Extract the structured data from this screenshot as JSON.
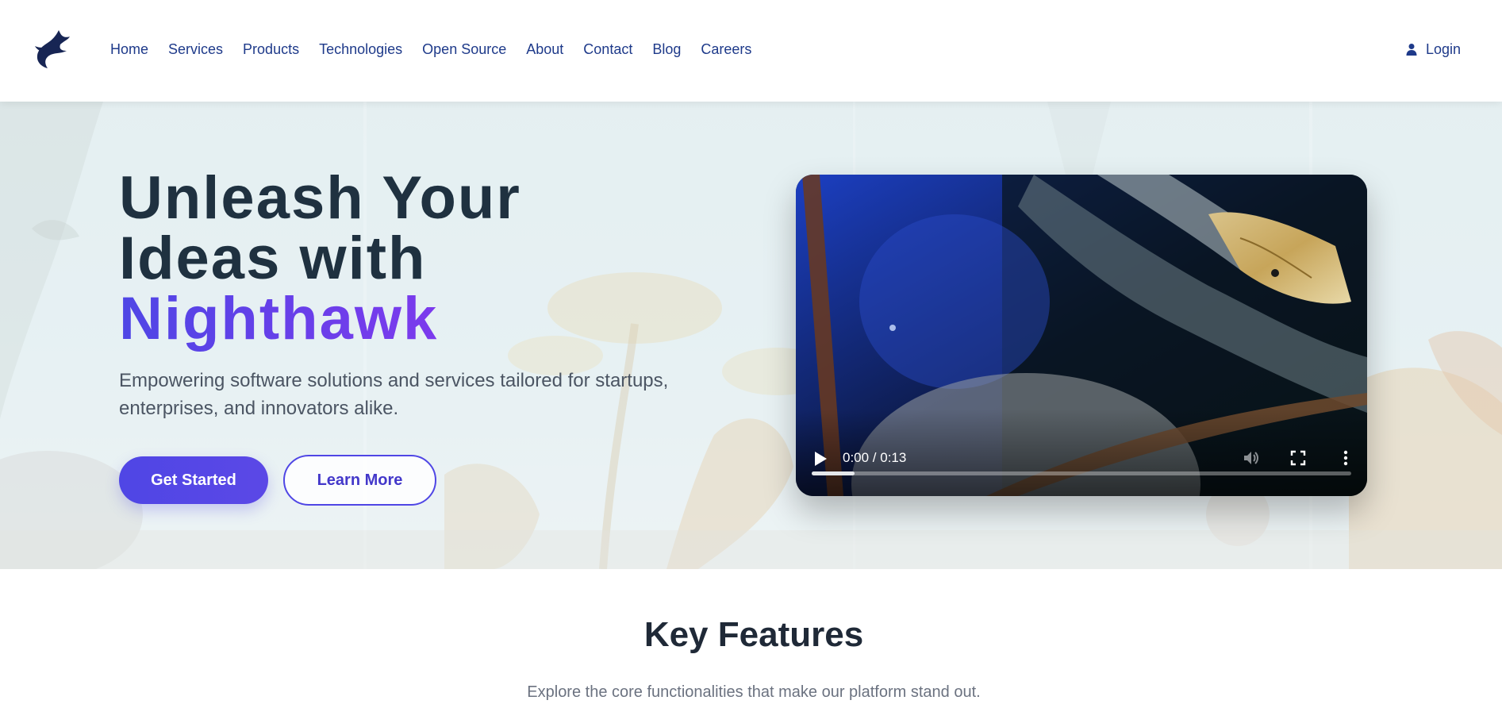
{
  "nav": {
    "links": [
      "Home",
      "Services",
      "Products",
      "Technologies",
      "Open Source",
      "About",
      "Contact",
      "Blog",
      "Careers"
    ],
    "login_label": "Login"
  },
  "hero": {
    "headline_line1": "Unleash Your",
    "headline_line2": "Ideas with",
    "headline_accent": "Nighthawk",
    "subtitle_line1": "Empowering software solutions and services tailored for startups,",
    "subtitle_line2": "enterprises, and innovators alike.",
    "primary_button": "Get Started",
    "secondary_button": "Learn More"
  },
  "video": {
    "time_display": "0:00 / 0:13",
    "progress_fraction": 0.08
  },
  "features": {
    "title": "Key Features",
    "subtitle": "Explore the core functionalities that make our platform stand out."
  },
  "colors": {
    "brand_navy": "#1e3a8a",
    "accent_indigo": "#4f46e5",
    "accent_purple": "#7c3aed",
    "headline_dark": "#1f3140"
  },
  "icons": {
    "logo": "nighthawk-bird-logo",
    "login": "user-icon",
    "play": "play-icon",
    "volume": "volume-icon",
    "fullscreen": "fullscreen-icon",
    "more": "more-vertical-icon"
  }
}
